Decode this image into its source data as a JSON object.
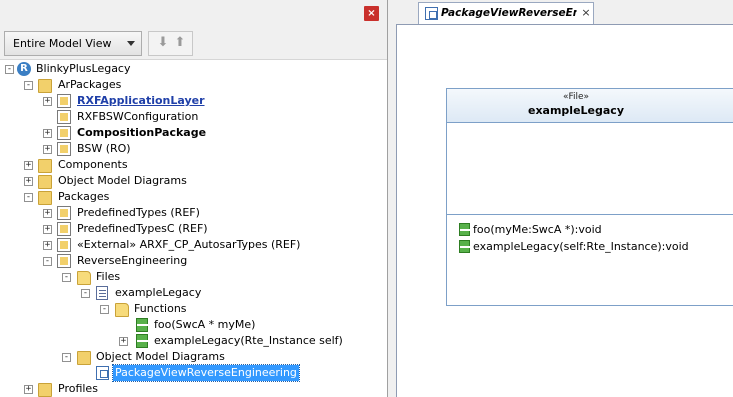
{
  "browser": {
    "close_glyph": "×",
    "view_selector": "Entire Model View",
    "nav": {
      "down_glyph": "⬇",
      "up_glyph": "⬆"
    },
    "tree": [
      {
        "label": "BlinkyPlusLegacy",
        "icon": "project-icon",
        "expander": "-"
      },
      {
        "label": "ArPackages",
        "icon": "folder-icon",
        "expander": "-"
      },
      {
        "label": "RXFApplicationLayer",
        "icon": "package-icon",
        "expander": "+",
        "style": "link"
      },
      {
        "label": "RXFBSWConfiguration",
        "icon": "package-icon",
        "expander": ""
      },
      {
        "label": "CompositionPackage",
        "icon": "package-icon",
        "expander": "+",
        "style": "bold"
      },
      {
        "label": "BSW (RO)",
        "icon": "package-icon",
        "expander": "+"
      },
      {
        "label": "Components",
        "icon": "folder-icon",
        "expander": "+"
      },
      {
        "label": "Object Model Diagrams",
        "icon": "folder-icon",
        "expander": "+"
      },
      {
        "label": "Packages",
        "icon": "folder-icon",
        "expander": "-"
      },
      {
        "label": "PredefinedTypes (REF)",
        "icon": "package-icon",
        "expander": "+"
      },
      {
        "label": "PredefinedTypesC (REF)",
        "icon": "package-icon",
        "expander": "+"
      },
      {
        "label": "«External» ARXF_CP_AutosarTypes (REF)",
        "icon": "external-package-icon",
        "expander": "+"
      },
      {
        "label": "ReverseEngineering",
        "icon": "package-icon",
        "expander": "-"
      },
      {
        "label": "Files",
        "icon": "folder-open-icon",
        "expander": "-"
      },
      {
        "label": "exampleLegacy",
        "icon": "file-icon",
        "expander": "-"
      },
      {
        "label": "Functions",
        "icon": "folder-open-icon",
        "expander": "-"
      },
      {
        "label": "foo(SwcA * myMe)",
        "icon": "function-icon",
        "expander": ""
      },
      {
        "label": "exampleLegacy(Rte_Instance self)",
        "icon": "function-icon",
        "expander": "+"
      },
      {
        "label": "Object Model Diagrams",
        "icon": "folder-icon",
        "expander": "-"
      },
      {
        "label": "PackageViewReverseEngineering",
        "icon": "diagram-icon",
        "expander": "",
        "style": "selected"
      },
      {
        "label": "Profiles",
        "icon": "folder-icon",
        "expander": "+"
      }
    ]
  },
  "editor": {
    "tab_label": "PackageViewReverseEng...",
    "tab_close": "×",
    "file_element": {
      "stereotype": "«File»",
      "name": "exampleLegacy",
      "operations": [
        "foo(myMe:SwcA *):void",
        "exampleLegacy(self:Rte_Instance):void"
      ]
    }
  },
  "colors": {
    "selection": "#3399ff",
    "close_button": "#c9302c",
    "link_text": "#1f3fa8",
    "class_border": "#7da0c8"
  }
}
